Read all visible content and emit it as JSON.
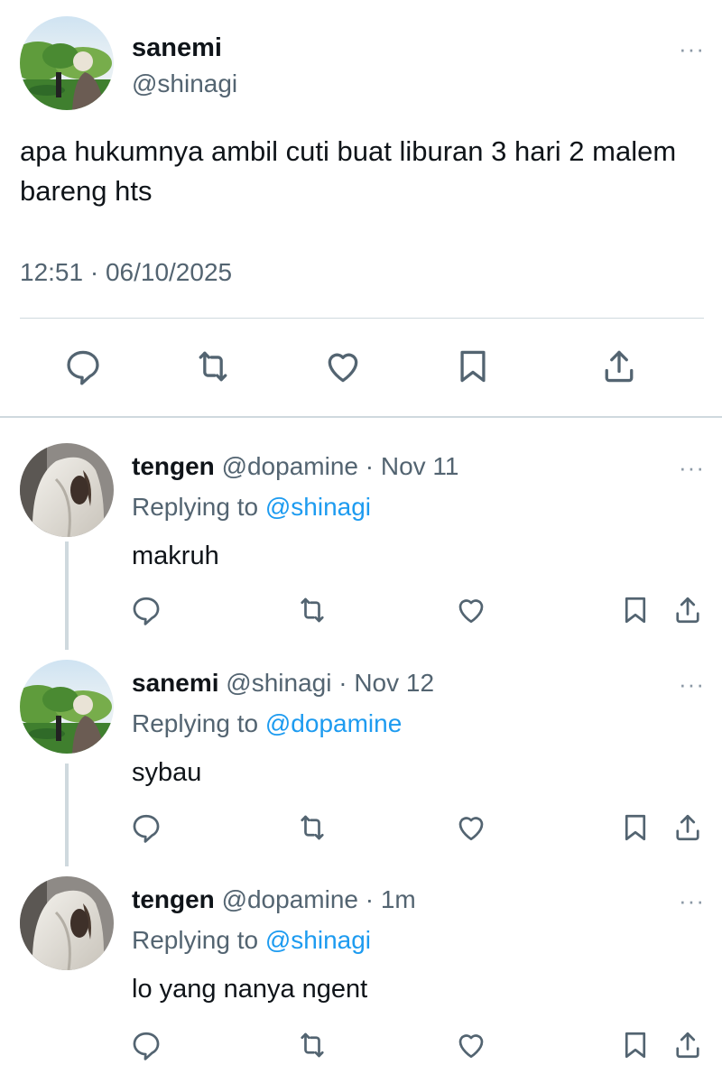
{
  "main_tweet": {
    "name": "sanemi",
    "handle": "@shinagi",
    "text": "apa hukumnya ambil cuti buat liburan 3 hari 2 malem bareng hts",
    "timestamp": "12:51 · 06/10/2025",
    "more_label": "···",
    "actions": [
      "reply-icon",
      "retweet-icon",
      "like-icon",
      "bookmark-icon",
      "share-icon"
    ]
  },
  "replies": [
    {
      "name": "tengen",
      "handle": "@dopamine",
      "time": "· Nov 11",
      "replying_prefix": "Replying to",
      "replying_to": "@shinagi",
      "text": "makruh",
      "more_label": "···"
    },
    {
      "name": "sanemi",
      "handle": "@shinagi",
      "time": "· Nov 12",
      "replying_prefix": "Replying to",
      "replying_to": "@dopamine",
      "text": "sybau",
      "more_label": "···"
    },
    {
      "name": "tengen",
      "handle": "@dopamine",
      "time": "· 1m",
      "replying_prefix": "Replying to",
      "replying_to": "@shinagi",
      "text": "lo yang nanya ngent",
      "more_label": "···"
    }
  ],
  "colors": {
    "link": "#1d9bf0",
    "secondary_text": "#536471",
    "primary_text": "#0f1419",
    "divider": "#cfd9de"
  }
}
